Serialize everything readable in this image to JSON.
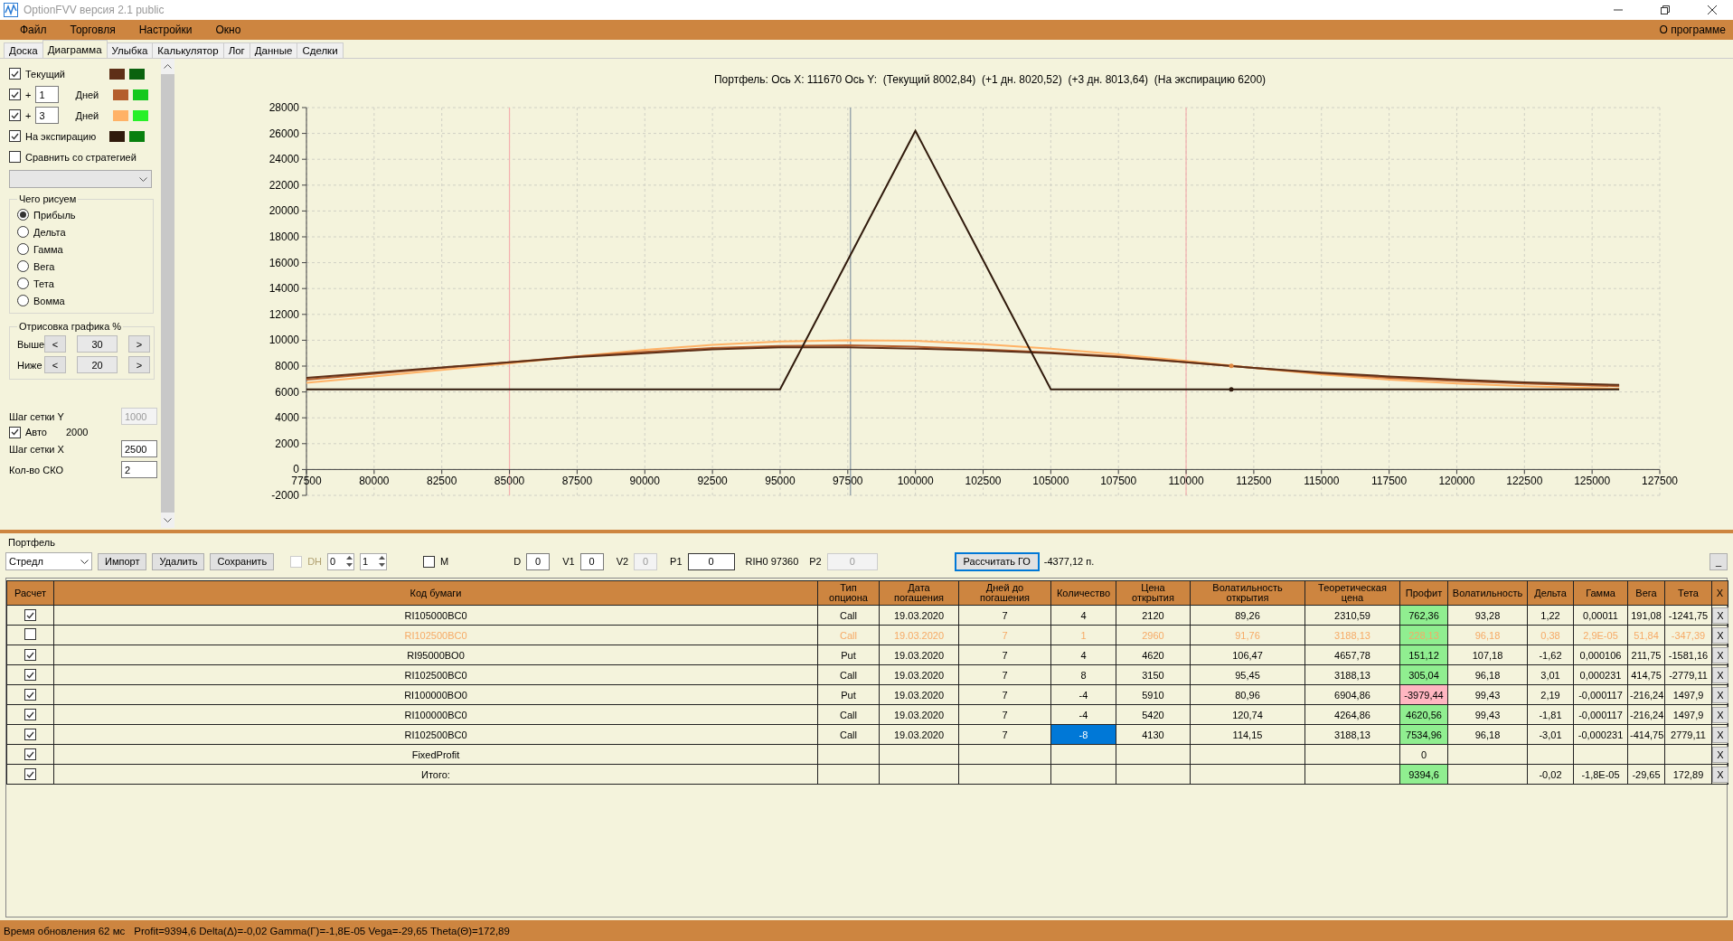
{
  "window": {
    "title": "OptionFVV версия 2.1 public"
  },
  "menu": {
    "items": [
      "Файл",
      "Торговля",
      "Настройки",
      "Окно"
    ],
    "right": "О программе"
  },
  "tabs": [
    {
      "label": "Доска",
      "selected": false
    },
    {
      "label": "Диаграмма",
      "selected": true
    },
    {
      "label": "Улыбка",
      "selected": false
    },
    {
      "label": "Калькулятор",
      "selected": false
    },
    {
      "label": "Лог",
      "selected": false
    },
    {
      "label": "Данные",
      "selected": false
    },
    {
      "label": "Сделки",
      "selected": false
    }
  ],
  "sidebar": {
    "curves": [
      {
        "kind": "plain",
        "label": "Текущий",
        "checked": true,
        "swatches": [
          {
            "color": "#5e2f17"
          },
          {
            "color": "#0b620f"
          }
        ]
      },
      {
        "kind": "days",
        "prefix": "+",
        "days": "1",
        "unit": "Дней",
        "checked": true,
        "swatches": [
          {
            "color": "#b45e2c"
          },
          {
            "color": "#14c81e"
          }
        ]
      },
      {
        "kind": "days",
        "prefix": "+",
        "days": "3",
        "unit": "Дней",
        "checked": true,
        "swatches": [
          {
            "color": "#ffb266"
          },
          {
            "color": "#28f028"
          }
        ]
      },
      {
        "kind": "plain",
        "label": "На экспирацию",
        "checked": true,
        "swatches": [
          {
            "color": "#301a0c"
          },
          {
            "color": "#08800e"
          }
        ]
      }
    ],
    "compare": {
      "label": "Сравнить со стратегией",
      "checked": false
    },
    "draw_group": {
      "title": "Чего рисуем",
      "options": [
        {
          "label": "Прибыль",
          "selected": true
        },
        {
          "label": "Дельта",
          "selected": false
        },
        {
          "label": "Гамма",
          "selected": false
        },
        {
          "label": "Вега",
          "selected": false
        },
        {
          "label": "Тета",
          "selected": false
        },
        {
          "label": "Вомма",
          "selected": false
        }
      ]
    },
    "range_group": {
      "title": "Отрисовка графика %",
      "rows": [
        {
          "label": "Выше",
          "value": "30",
          "dec": "<",
          "inc": ">"
        },
        {
          "label": "Ниже",
          "value": "20",
          "dec": "<",
          "inc": ">"
        }
      ]
    },
    "grid_y": {
      "label": "Шаг сетки Y",
      "value": "1000",
      "disabled": true
    },
    "auto": {
      "label": "Авто",
      "checked": true,
      "value": "2000"
    },
    "grid_x": {
      "label": "Шаг сетки X",
      "value": "2500"
    },
    "sko": {
      "label": "Кол-во СКО",
      "value": "2"
    }
  },
  "chart": {
    "title": "Портфель: Ось X: 111670 Ось Y:  (Текущий 8002,84)  (+1 дн. 8020,52)  (+3 дн. 8013,64)  (На экспирацию 6200)",
    "chart_data": {
      "type": "line",
      "x": [
        77500,
        80000,
        82500,
        85000,
        87500,
        90000,
        92500,
        95000,
        97500,
        100000,
        102500,
        105000,
        107500,
        110000,
        112500,
        115000,
        117500,
        120000,
        122500,
        125000,
        126000
      ],
      "series": [
        {
          "color": "#ffb266",
          "values": [
            6700,
            7200,
            7700,
            8200,
            8750,
            9250,
            9650,
            9900,
            10000,
            9950,
            9700,
            9350,
            8900,
            8400,
            7850,
            7350,
            6950,
            6650,
            6450,
            6300,
            6250
          ]
        },
        {
          "color": "#b45e2c",
          "values": [
            6950,
            7400,
            7850,
            8300,
            8750,
            9100,
            9400,
            9550,
            9600,
            9500,
            9300,
            9050,
            8750,
            8300,
            7850,
            7450,
            7100,
            6850,
            6650,
            6500,
            6450
          ]
        },
        {
          "color": "#5e2f17",
          "values": [
            7100,
            7500,
            7900,
            8300,
            8700,
            9000,
            9300,
            9450,
            9450,
            9350,
            9200,
            9000,
            8700,
            8300,
            7850,
            7500,
            7200,
            6950,
            6750,
            6600,
            6550
          ]
        },
        {
          "color": "#301a0c",
          "values": [
            6200,
            6200,
            6200,
            6200,
            6200,
            6200,
            6200,
            6200,
            16200,
            26200,
            16200,
            6200,
            6200,
            6200,
            6200,
            6200,
            6200,
            6200,
            6200,
            6200,
            6200
          ]
        }
      ],
      "xlim": [
        77500,
        127500
      ],
      "ylim": [
        -2000,
        28000
      ],
      "xticks": [
        77500,
        80000,
        82500,
        85000,
        87500,
        90000,
        92500,
        95000,
        97500,
        100000,
        102500,
        105000,
        107500,
        110000,
        112500,
        115000,
        117500,
        120000,
        122500,
        125000,
        127500
      ],
      "yticks": [
        -2000,
        0,
        2000,
        4000,
        6000,
        8000,
        10000,
        12000,
        14000,
        16000,
        18000,
        20000,
        22000,
        24000,
        26000,
        28000
      ],
      "grid": true,
      "ref_lines": [
        {
          "axis": "x",
          "value": 97600
        }
      ]
    }
  },
  "portfolio": {
    "title": "Портфель",
    "toolbar": {
      "strategy": "Стредл",
      "buttons": [
        "Импорт",
        "Удалить",
        "Сохранить"
      ],
      "dh": {
        "label": "DH",
        "checked": false,
        "disabled": true
      },
      "spin1": "0",
      "spin2": "1",
      "m": {
        "label": "M",
        "checked": false
      },
      "fields": [
        {
          "label": "D",
          "value": "0",
          "disabled": false,
          "wide": false
        },
        {
          "label": "V1",
          "value": "0",
          "disabled": false,
          "wide": false
        },
        {
          "label": "V2",
          "value": "0",
          "disabled": true,
          "wide": false
        },
        {
          "label": "P1",
          "value": "0",
          "disabled": false,
          "wide": true
        }
      ],
      "ticker": "RIH0 97360",
      "p2": {
        "label": "P2",
        "value": "0",
        "disabled": true
      },
      "calc_button": "Рассчитать ГО",
      "margin": "-4377,12 п.",
      "collapse": "_"
    },
    "columns": [
      "Расчет",
      "Код бумаги",
      "Тип\nопциона",
      "Дата\nпогашения",
      "Дней до\nпогашения",
      "Количество",
      "Цена\nоткрытия",
      "Волатильность\nоткрытия",
      "Теоретическая\nцена",
      "Профит",
      "Волатильность",
      "Дельта",
      "Гамма",
      "Вега",
      "Тета",
      "X"
    ],
    "rows": [
      {
        "checked": true,
        "code": "RI105000BC0",
        "type": "Call",
        "date": "19.03.2020",
        "days": "7",
        "qty": "4",
        "qty_selected": false,
        "open_price": "2120",
        "open_vol": "89,26",
        "theor": "2310,59",
        "profit": "762,36",
        "loss": false,
        "vol": "93,28",
        "delta": "1,22",
        "gamma": "0,00011",
        "vega": "191,08",
        "theta": "-1241,75",
        "remove": "X"
      },
      {
        "checked": false,
        "code": "RI102500BC0",
        "type": "Call",
        "date": "19.03.2020",
        "days": "7",
        "qty": "1",
        "qty_selected": false,
        "open_price": "2960",
        "open_vol": "91,76",
        "theor": "3188,13",
        "profit": "228,13",
        "loss": false,
        "vol": "96,18",
        "delta": "0,38",
        "gamma": "2,9E-05",
        "vega": "51,84",
        "theta": "-347,39",
        "remove": "X"
      },
      {
        "checked": true,
        "code": "RI95000BO0",
        "type": "Put",
        "date": "19.03.2020",
        "days": "7",
        "qty": "4",
        "qty_selected": false,
        "open_price": "4620",
        "open_vol": "106,47",
        "theor": "4657,78",
        "profit": "151,12",
        "loss": false,
        "vol": "107,18",
        "delta": "-1,62",
        "gamma": "0,000106",
        "vega": "211,75",
        "theta": "-1581,16",
        "remove": "X"
      },
      {
        "checked": true,
        "code": "RI102500BC0",
        "type": "Call",
        "date": "19.03.2020",
        "days": "7",
        "qty": "8",
        "qty_selected": false,
        "open_price": "3150",
        "open_vol": "95,45",
        "theor": "3188,13",
        "profit": "305,04",
        "loss": false,
        "vol": "96,18",
        "delta": "3,01",
        "gamma": "0,000231",
        "vega": "414,75",
        "theta": "-2779,11",
        "remove": "X"
      },
      {
        "checked": true,
        "code": "RI100000BO0",
        "type": "Put",
        "date": "19.03.2020",
        "days": "7",
        "qty": "-4",
        "qty_selected": false,
        "open_price": "5910",
        "open_vol": "80,96",
        "theor": "6904,86",
        "profit": "-3979,44",
        "loss": true,
        "vol": "99,43",
        "delta": "2,19",
        "gamma": "-0,000117",
        "vega": "-216,24",
        "theta": "1497,9",
        "remove": "X"
      },
      {
        "checked": true,
        "code": "RI100000BC0",
        "type": "Call",
        "date": "19.03.2020",
        "days": "7",
        "qty": "-4",
        "qty_selected": false,
        "open_price": "5420",
        "open_vol": "120,74",
        "theor": "4264,86",
        "profit": "4620,56",
        "loss": false,
        "vol": "99,43",
        "delta": "-1,81",
        "gamma": "-0,000117",
        "vega": "-216,24",
        "theta": "1497,9",
        "remove": "X"
      },
      {
        "checked": true,
        "code": "RI102500BC0",
        "type": "Call",
        "date": "19.03.2020",
        "days": "7",
        "qty": "-8",
        "qty_selected": true,
        "open_price": "4130",
        "open_vol": "114,15",
        "theor": "3188,13",
        "profit": "7534,96",
        "loss": false,
        "vol": "96,18",
        "delta": "-3,01",
        "gamma": "-0,000231",
        "vega": "-414,75",
        "theta": "2779,11",
        "remove": "X"
      },
      {
        "checked": true,
        "code": "FixedProfit",
        "profit": "0",
        "remove": "X"
      },
      {
        "checked": true,
        "code": "Итого:",
        "profit": "9394,6",
        "loss": false,
        "delta": "-0,02",
        "gamma": "-1,8E-05",
        "vega": "-29,65",
        "theta": "172,89",
        "remove": "X"
      }
    ]
  },
  "status_bar": {
    "update": "Время обновления 62 мс",
    "summary": "Profit=9394,6 Delta(Δ)=-0,02 Gamma(Γ)=-1,8E-05 Vega=-29,65 Theta(Θ)=172,89"
  }
}
